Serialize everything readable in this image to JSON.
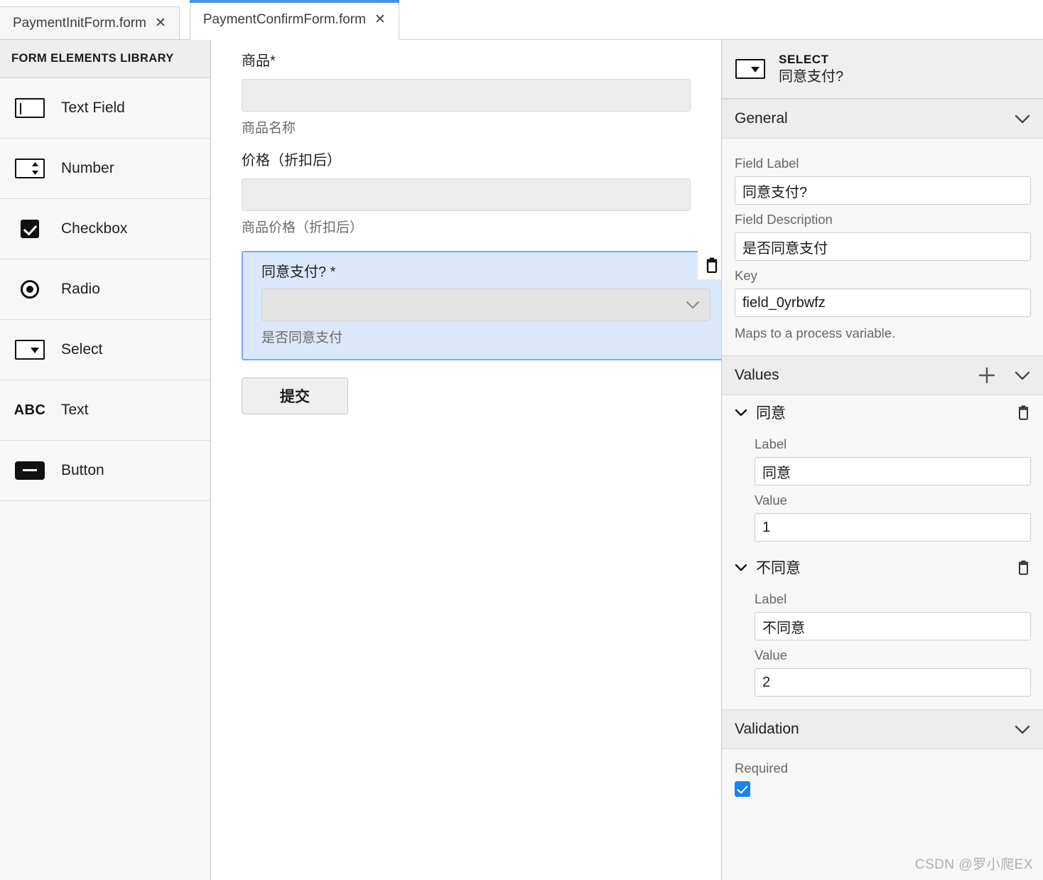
{
  "tabs": [
    {
      "label": "PaymentInitForm.form",
      "close": "✕",
      "active": false
    },
    {
      "label": "PaymentConfirmForm.form",
      "close": "✕",
      "active": true
    }
  ],
  "sidebar": {
    "title": "FORM ELEMENTS LIBRARY",
    "items": [
      {
        "label": "Text Field",
        "icon": "text-field-icon"
      },
      {
        "label": "Number",
        "icon": "number-icon"
      },
      {
        "label": "Checkbox",
        "icon": "checkbox-icon"
      },
      {
        "label": "Radio",
        "icon": "radio-icon"
      },
      {
        "label": "Select",
        "icon": "select-icon"
      },
      {
        "label": "Text",
        "icon": "abc-text-icon"
      },
      {
        "label": "Button",
        "icon": "button-icon"
      }
    ]
  },
  "canvas": {
    "fields": [
      {
        "label": "商品*",
        "value": "",
        "description": "商品名称"
      },
      {
        "label": "价格（折扣后）",
        "value": "",
        "description": "商品价格（折扣后）"
      }
    ],
    "selected_field": {
      "label": "同意支付?  *",
      "value": "",
      "description": "是否同意支付",
      "delete_icon": "trash-icon",
      "chevron_icon": "chevron-down-icon"
    },
    "submit_label": "提交"
  },
  "inspector": {
    "type": "SELECT",
    "name": "同意支付?",
    "icon": "select-icon",
    "general": {
      "title": "General",
      "collapse_icon": "chevron-down-icon",
      "field_label_label": "Field Label",
      "field_label_value": "同意支付?",
      "field_description_label": "Field Description",
      "field_description_value": "是否同意支付",
      "key_label": "Key",
      "key_value": "field_0yrbwfz",
      "key_hint": "Maps to a process variable."
    },
    "values": {
      "title": "Values",
      "add_icon": "plus-icon",
      "collapse_icon": "chevron-down-icon",
      "label_caption": "Label",
      "value_caption": "Value",
      "entries": [
        {
          "title": "同意",
          "label": "同意",
          "value": "1",
          "expand_icon": "chevron-down-icon",
          "delete_icon": "trash-icon"
        },
        {
          "title": "不同意",
          "label": "不同意",
          "value": "2",
          "expand_icon": "chevron-down-icon",
          "delete_icon": "trash-icon"
        }
      ]
    },
    "validation": {
      "title": "Validation",
      "collapse_icon": "chevron-down-icon",
      "required_label": "Required",
      "required_checked": true
    }
  },
  "watermark": "CSDN @罗小爬EX",
  "colors": {
    "accent_blue": "#4a90e8",
    "selection_fill": "#dbe8fb",
    "selection_border": "#7eaaf0",
    "checkbox_blue": "#1a81f5",
    "panel_bg": "#f7f7f7",
    "section_head_bg": "#ededed"
  }
}
